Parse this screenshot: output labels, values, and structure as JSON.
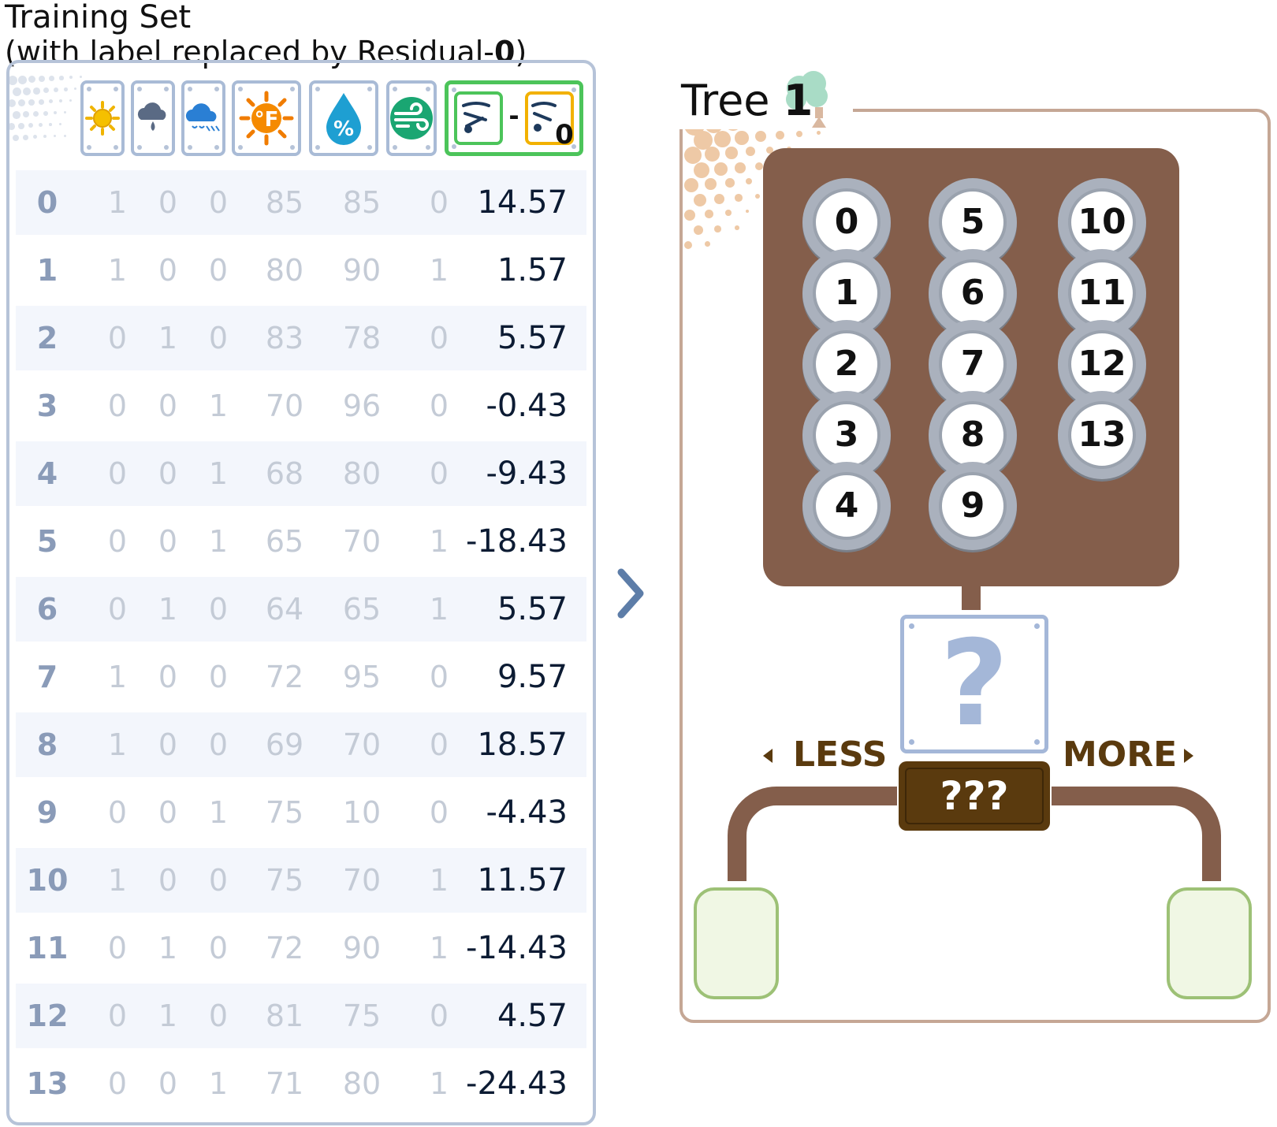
{
  "header": {
    "title": "Training Set",
    "subtitle_prefix": "(with label replaced by Residual-",
    "subtitle_num": "0",
    "subtitle_suffix": ")"
  },
  "columns": {
    "icons": [
      "sun-icon",
      "rain-cloud-icon",
      "snow-cloud-icon",
      "temperature-icon",
      "humidity-icon",
      "wind-icon",
      "residual-icon"
    ],
    "residual_subscript": "0"
  },
  "rows": [
    {
      "index": "0",
      "f1": "1",
      "f2": "0",
      "f3": "0",
      "temp": "85",
      "hum": "85",
      "wind": "0",
      "residual": "14.57"
    },
    {
      "index": "1",
      "f1": "1",
      "f2": "0",
      "f3": "0",
      "temp": "80",
      "hum": "90",
      "wind": "1",
      "residual": "1.57"
    },
    {
      "index": "2",
      "f1": "0",
      "f2": "1",
      "f3": "0",
      "temp": "83",
      "hum": "78",
      "wind": "0",
      "residual": "5.57"
    },
    {
      "index": "3",
      "f1": "0",
      "f2": "0",
      "f3": "1",
      "temp": "70",
      "hum": "96",
      "wind": "0",
      "residual": "-0.43"
    },
    {
      "index": "4",
      "f1": "0",
      "f2": "0",
      "f3": "1",
      "temp": "68",
      "hum": "80",
      "wind": "0",
      "residual": "-9.43"
    },
    {
      "index": "5",
      "f1": "0",
      "f2": "0",
      "f3": "1",
      "temp": "65",
      "hum": "70",
      "wind": "1",
      "residual": "-18.43"
    },
    {
      "index": "6",
      "f1": "0",
      "f2": "1",
      "f3": "0",
      "temp": "64",
      "hum": "65",
      "wind": "1",
      "residual": "5.57"
    },
    {
      "index": "7",
      "f1": "1",
      "f2": "0",
      "f3": "0",
      "temp": "72",
      "hum": "95",
      "wind": "0",
      "residual": "9.57"
    },
    {
      "index": "8",
      "f1": "1",
      "f2": "0",
      "f3": "0",
      "temp": "69",
      "hum": "70",
      "wind": "0",
      "residual": "18.57"
    },
    {
      "index": "9",
      "f1": "0",
      "f2": "0",
      "f3": "1",
      "temp": "75",
      "hum": "10",
      "wind": "0",
      "residual": "-4.43"
    },
    {
      "index": "10",
      "f1": "1",
      "f2": "0",
      "f3": "0",
      "temp": "75",
      "hum": "70",
      "wind": "1",
      "residual": "11.57"
    },
    {
      "index": "11",
      "f1": "0",
      "f2": "1",
      "f3": "0",
      "temp": "72",
      "hum": "90",
      "wind": "1",
      "residual": "-14.43"
    },
    {
      "index": "12",
      "f1": "0",
      "f2": "1",
      "f3": "0",
      "temp": "81",
      "hum": "75",
      "wind": "0",
      "residual": "4.57"
    },
    {
      "index": "13",
      "f1": "0",
      "f2": "0",
      "f3": "1",
      "temp": "71",
      "hum": "80",
      "wind": "1",
      "residual": "-24.43"
    }
  ],
  "tree": {
    "title_prefix": "Tree",
    "number": "1",
    "samples": [
      [
        "0",
        "1",
        "2",
        "3",
        "4"
      ],
      [
        "5",
        "6",
        "7",
        "8",
        "9"
      ],
      [
        "10",
        "11",
        "12",
        "13"
      ]
    ],
    "question": "?",
    "split_label": "???",
    "less_label": "LESS",
    "more_label": "MORE"
  },
  "colors": {
    "node_brown": "#845e4b",
    "plate_brown": "#5a3a0e",
    "leaf_fill": "#f0f7e4",
    "leaf_border": "#9dc176",
    "panel_border_left": "#b6c3d8",
    "panel_border_right": "#c5a795"
  }
}
